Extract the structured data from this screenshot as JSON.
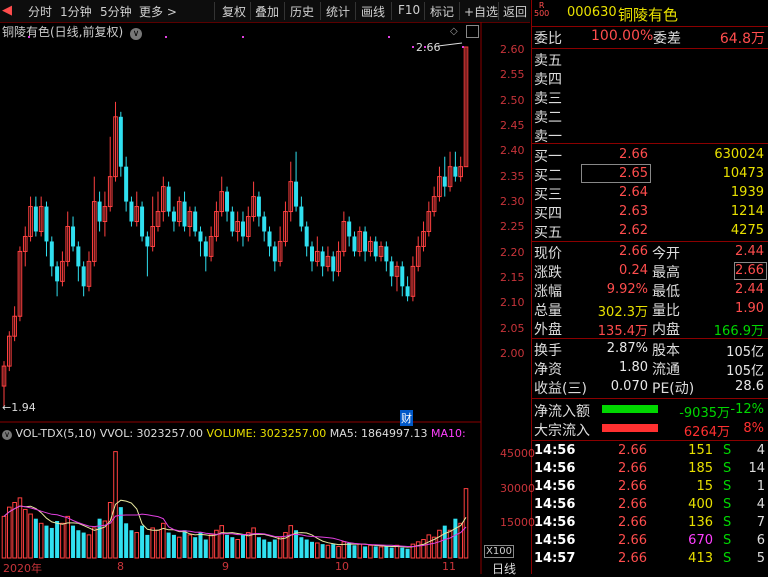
{
  "toolbar": {
    "items": [
      "分时",
      "1分钟",
      "5分钟",
      "更多 >",
      "复权",
      "叠加",
      "历史",
      "统计",
      "画线",
      "F10",
      "标记",
      "+自选",
      "返回"
    ]
  },
  "chart": {
    "title": "铜陵有色(日线,前复权)",
    "price_ticks": [
      "2.60",
      "2.55",
      "2.50",
      "2.45",
      "2.40",
      "2.35",
      "2.30",
      "2.25",
      "2.20",
      "2.15",
      "2.10",
      "2.05",
      "2.00"
    ],
    "high_marker": "2.66",
    "low_marker": "1.94",
    "fin_marker": "财",
    "vol_header": {
      "name": "VOL-TDX(5,10)",
      "vvol": "VVOL: 3023257.00",
      "volume": "VOLUME: 3023257.00",
      "ma5": "MA5: 1864997.13",
      "ma10": "MA10:"
    },
    "vol_ticks": [
      "45000",
      "30000",
      "15000"
    ],
    "vol_unit": "X100",
    "x_labels": [
      "2020年",
      "8",
      "9",
      "10",
      "11"
    ],
    "x_unit": "日线"
  },
  "chart_data": {
    "type": "candlestick",
    "ylim": [
      1.94,
      2.66
    ],
    "candles": [
      [
        1.98,
        2.02,
        1.94,
        2.03
      ],
      [
        2.02,
        2.08,
        2.01,
        2.09
      ],
      [
        2.08,
        2.12,
        2.07,
        2.14
      ],
      [
        2.12,
        2.25,
        2.11,
        2.26
      ],
      [
        2.25,
        2.28,
        2.22,
        2.3
      ],
      [
        2.28,
        2.34,
        2.27,
        2.36
      ],
      [
        2.34,
        2.29,
        2.28,
        2.36
      ],
      [
        2.29,
        2.34,
        2.28,
        2.36
      ],
      [
        2.34,
        2.27,
        2.24,
        2.35
      ],
      [
        2.27,
        2.22,
        2.2,
        2.28
      ],
      [
        2.22,
        2.19,
        2.16,
        2.23
      ],
      [
        2.19,
        2.23,
        2.18,
        2.25
      ],
      [
        2.23,
        2.3,
        2.22,
        2.33
      ],
      [
        2.3,
        2.26,
        2.25,
        2.32
      ],
      [
        2.26,
        2.22,
        2.19,
        2.27
      ],
      [
        2.22,
        2.18,
        2.16,
        2.23
      ],
      [
        2.18,
        2.23,
        2.17,
        2.25
      ],
      [
        2.23,
        2.35,
        2.22,
        2.4
      ],
      [
        2.35,
        2.31,
        2.29,
        2.37
      ],
      [
        2.31,
        2.34,
        2.28,
        2.37
      ],
      [
        2.34,
        2.4,
        2.33,
        2.48
      ],
      [
        2.4,
        2.52,
        2.39,
        2.55
      ],
      [
        2.52,
        2.42,
        2.4,
        2.53
      ],
      [
        2.42,
        2.35,
        2.33,
        2.44
      ],
      [
        2.35,
        2.31,
        2.3,
        2.36
      ],
      [
        2.31,
        2.34,
        2.3,
        2.37
      ],
      [
        2.34,
        2.28,
        2.27,
        2.35
      ],
      [
        2.28,
        2.26,
        2.2,
        2.29
      ],
      [
        2.26,
        2.3,
        2.25,
        2.36
      ],
      [
        2.3,
        2.33,
        2.29,
        2.37
      ],
      [
        2.33,
        2.38,
        2.31,
        2.4
      ],
      [
        2.38,
        2.33,
        2.32,
        2.39
      ],
      [
        2.33,
        2.31,
        2.29,
        2.34
      ],
      [
        2.31,
        2.35,
        2.3,
        2.36
      ],
      [
        2.35,
        2.3,
        2.29,
        2.37
      ],
      [
        2.3,
        2.33,
        2.28,
        2.34
      ],
      [
        2.33,
        2.29,
        2.28,
        2.34
      ],
      [
        2.29,
        2.27,
        2.24,
        2.3
      ],
      [
        2.27,
        2.24,
        2.21,
        2.28
      ],
      [
        2.24,
        2.28,
        2.23,
        2.3
      ],
      [
        2.28,
        2.33,
        2.27,
        2.35
      ],
      [
        2.33,
        2.37,
        2.32,
        2.4
      ],
      [
        2.37,
        2.33,
        2.31,
        2.38
      ],
      [
        2.33,
        2.29,
        2.28,
        2.34
      ],
      [
        2.29,
        2.31,
        2.27,
        2.33
      ],
      [
        2.31,
        2.28,
        2.26,
        2.33
      ],
      [
        2.28,
        2.32,
        2.27,
        2.34
      ],
      [
        2.32,
        2.36,
        2.31,
        2.39
      ],
      [
        2.36,
        2.32,
        2.3,
        2.37
      ],
      [
        2.32,
        2.29,
        2.27,
        2.33
      ],
      [
        2.29,
        2.26,
        2.24,
        2.3
      ],
      [
        2.26,
        2.23,
        2.21,
        2.27
      ],
      [
        2.23,
        2.27,
        2.22,
        2.3
      ],
      [
        2.27,
        2.33,
        2.26,
        2.35
      ],
      [
        2.33,
        2.39,
        2.31,
        2.43
      ],
      [
        2.39,
        2.34,
        2.33,
        2.45
      ],
      [
        2.34,
        2.3,
        2.29,
        2.36
      ],
      [
        2.3,
        2.26,
        2.24,
        2.31
      ],
      [
        2.26,
        2.23,
        2.21,
        2.27
      ],
      [
        2.23,
        2.25,
        2.22,
        2.28
      ],
      [
        2.25,
        2.22,
        2.2,
        2.26
      ],
      [
        2.22,
        2.24,
        2.21,
        2.26
      ],
      [
        2.24,
        2.21,
        2.19,
        2.25
      ],
      [
        2.21,
        2.25,
        2.2,
        2.27
      ],
      [
        2.25,
        2.31,
        2.24,
        2.33
      ],
      [
        2.31,
        2.28,
        2.26,
        2.32
      ],
      [
        2.28,
        2.25,
        2.24,
        2.29
      ],
      [
        2.25,
        2.29,
        2.24,
        2.3
      ],
      [
        2.29,
        2.25,
        2.23,
        2.3
      ],
      [
        2.25,
        2.27,
        2.24,
        2.28
      ],
      [
        2.27,
        2.24,
        2.23,
        2.28
      ],
      [
        2.24,
        2.26,
        2.23,
        2.27
      ],
      [
        2.26,
        2.23,
        2.21,
        2.27
      ],
      [
        2.23,
        2.2,
        2.18,
        2.24
      ],
      [
        2.2,
        2.22,
        2.17,
        2.23
      ],
      [
        2.22,
        2.18,
        2.16,
        2.23
      ],
      [
        2.18,
        2.16,
        2.15,
        2.2
      ],
      [
        2.16,
        2.22,
        2.15,
        2.24
      ],
      [
        2.22,
        2.26,
        2.21,
        2.28
      ],
      [
        2.26,
        2.29,
        2.25,
        2.31
      ],
      [
        2.29,
        2.33,
        2.28,
        2.35
      ],
      [
        2.33,
        2.36,
        2.32,
        2.38
      ],
      [
        2.36,
        2.4,
        2.35,
        2.42
      ],
      [
        2.4,
        2.38,
        2.36,
        2.44
      ],
      [
        2.38,
        2.42,
        2.37,
        2.45
      ],
      [
        2.42,
        2.4,
        2.39,
        2.45
      ],
      [
        2.4,
        2.42,
        2.39,
        2.44
      ],
      [
        2.42,
        2.66,
        2.42,
        2.66
      ]
    ],
    "volumes": [
      18000,
      22000,
      24000,
      26000,
      21000,
      19000,
      17000,
      15000,
      14000,
      13000,
      16000,
      15000,
      18000,
      14000,
      12000,
      11000,
      10000,
      13000,
      17000,
      16000,
      24000,
      46000,
      22000,
      15000,
      12000,
      11000,
      14000,
      10000,
      13000,
      12000,
      15000,
      11000,
      10000,
      9000,
      12000,
      10000,
      9000,
      11000,
      8000,
      10000,
      12000,
      14000,
      10000,
      9000,
      8000,
      10000,
      11000,
      13000,
      9000,
      8000,
      7000,
      8000,
      9000,
      11000,
      14000,
      12000,
      9000,
      8000,
      7000,
      6500,
      6000,
      5500,
      6000,
      5000,
      7000,
      6500,
      5500,
      6000,
      5000,
      5500,
      5000,
      4800,
      5000,
      4500,
      5500,
      4500,
      4000,
      6000,
      7000,
      8000,
      10000,
      9000,
      12000,
      14000,
      12000,
      17000,
      15000,
      30000
    ]
  },
  "quote": {
    "code": "000630",
    "name": "铜陵有色",
    "badge_top": "R",
    "badge_bottom": "500",
    "weibi_label": "委比",
    "weibi": "100.00%",
    "weicha_label": "委差",
    "weicha": "64.8万",
    "sell": [
      {
        "label": "卖五",
        "price": "",
        "vol": ""
      },
      {
        "label": "卖四",
        "price": "",
        "vol": ""
      },
      {
        "label": "卖三",
        "price": "",
        "vol": ""
      },
      {
        "label": "卖二",
        "price": "",
        "vol": ""
      },
      {
        "label": "卖一",
        "price": "",
        "vol": ""
      }
    ],
    "buy": [
      {
        "label": "买一",
        "price": "2.66",
        "vol": "630024"
      },
      {
        "label": "买二",
        "price": "2.65",
        "vol": "10473"
      },
      {
        "label": "买三",
        "price": "2.64",
        "vol": "1939"
      },
      {
        "label": "买四",
        "price": "2.63",
        "vol": "1214"
      },
      {
        "label": "买五",
        "price": "2.62",
        "vol": "4275"
      }
    ],
    "stats": [
      {
        "l1": "现价",
        "v1": "2.66",
        "c1": "red",
        "l2": "今开",
        "v2": "2.44",
        "c2": "red"
      },
      {
        "l1": "涨跌",
        "v1": "0.24",
        "c1": "red",
        "l2": "最高",
        "v2": "2.66",
        "c2": "red"
      },
      {
        "l1": "涨幅",
        "v1": "9.92%",
        "c1": "red",
        "l2": "最低",
        "v2": "2.44",
        "c2": "red"
      },
      {
        "l1": "总量",
        "v1": "302.3万",
        "c1": "yellow",
        "l2": "量比",
        "v2": "1.90",
        "c2": "red"
      },
      {
        "l1": "外盘",
        "v1": "135.4万",
        "c1": "red",
        "l2": "内盘",
        "v2": "166.9万",
        "c2": "green"
      }
    ],
    "stats2": [
      {
        "l1": "换手",
        "v1": "2.87%",
        "l2": "股本",
        "v2": "105亿"
      },
      {
        "l1": "净资",
        "v1": "1.80",
        "l2": "流通",
        "v2": "105亿"
      },
      {
        "l1": "收益(三)",
        "v1": "0.070",
        "l2": "PE(动)",
        "v2": "28.6"
      }
    ],
    "flow": [
      {
        "label": "净流入额",
        "value": "-9035万",
        "pct": "-12%",
        "color": "#00d800"
      },
      {
        "label": "大宗流入",
        "value": "6264万",
        "pct": "8%",
        "color": "#ff3030"
      }
    ],
    "ticks": [
      {
        "t": "14:56",
        "p": "2.66",
        "v": "151",
        "s": "S",
        "n": "4"
      },
      {
        "t": "14:56",
        "p": "2.66",
        "v": "185",
        "s": "S",
        "n": "14"
      },
      {
        "t": "14:56",
        "p": "2.66",
        "v": "15",
        "s": "S",
        "n": "1"
      },
      {
        "t": "14:56",
        "p": "2.66",
        "v": "400",
        "s": "S",
        "n": "4"
      },
      {
        "t": "14:56",
        "p": "2.66",
        "v": "136",
        "s": "S",
        "n": "7"
      },
      {
        "t": "14:56",
        "p": "2.66",
        "v": "670",
        "s": "S",
        "n": "6"
      },
      {
        "t": "14:57",
        "p": "2.66",
        "v": "413",
        "s": "S",
        "n": "5"
      }
    ]
  }
}
